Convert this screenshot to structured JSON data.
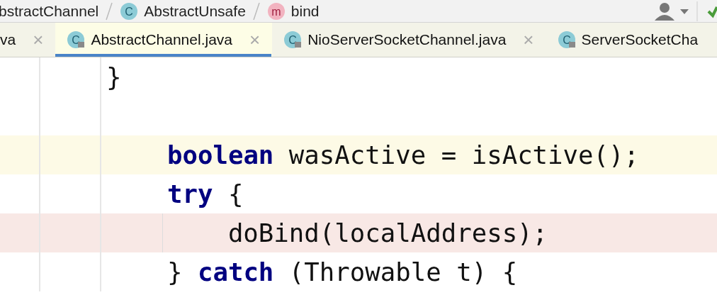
{
  "breadcrumbs": [
    {
      "label": "bstractChannel"
    },
    {
      "label": "AbstractUnsafe",
      "icon_letter": "C",
      "kind": "class"
    },
    {
      "label": "bind",
      "icon_letter": "m",
      "kind": "method"
    }
  ],
  "tabs": [
    {
      "label": "va",
      "selected": false,
      "close": "×"
    },
    {
      "label": "AbstractChannel.java",
      "icon_letter": "C",
      "selected": true,
      "close": "×"
    },
    {
      "label": "NioServerSocketChannel.java",
      "icon_letter": "C",
      "selected": false,
      "close": "×"
    },
    {
      "label": "ServerSocketCha",
      "icon_letter": "C",
      "selected": false
    }
  ],
  "editor": {
    "lines": [
      {
        "code": "}",
        "current": false,
        "breakpoint": false
      },
      {
        "current": false,
        "breakpoint": false
      },
      {
        "code": "    **boolean** wasActive = isActive();",
        "current": true,
        "breakpoint": false
      },
      {
        "code": "    **try** {",
        "current": false,
        "breakpoint": false
      },
      {
        "code": "        doBind(localAddress);",
        "current": false,
        "breakpoint": true
      },
      {
        "code": "    } **catch** (Throwable t) {",
        "current": false,
        "breakpoint": false
      }
    ]
  }
}
